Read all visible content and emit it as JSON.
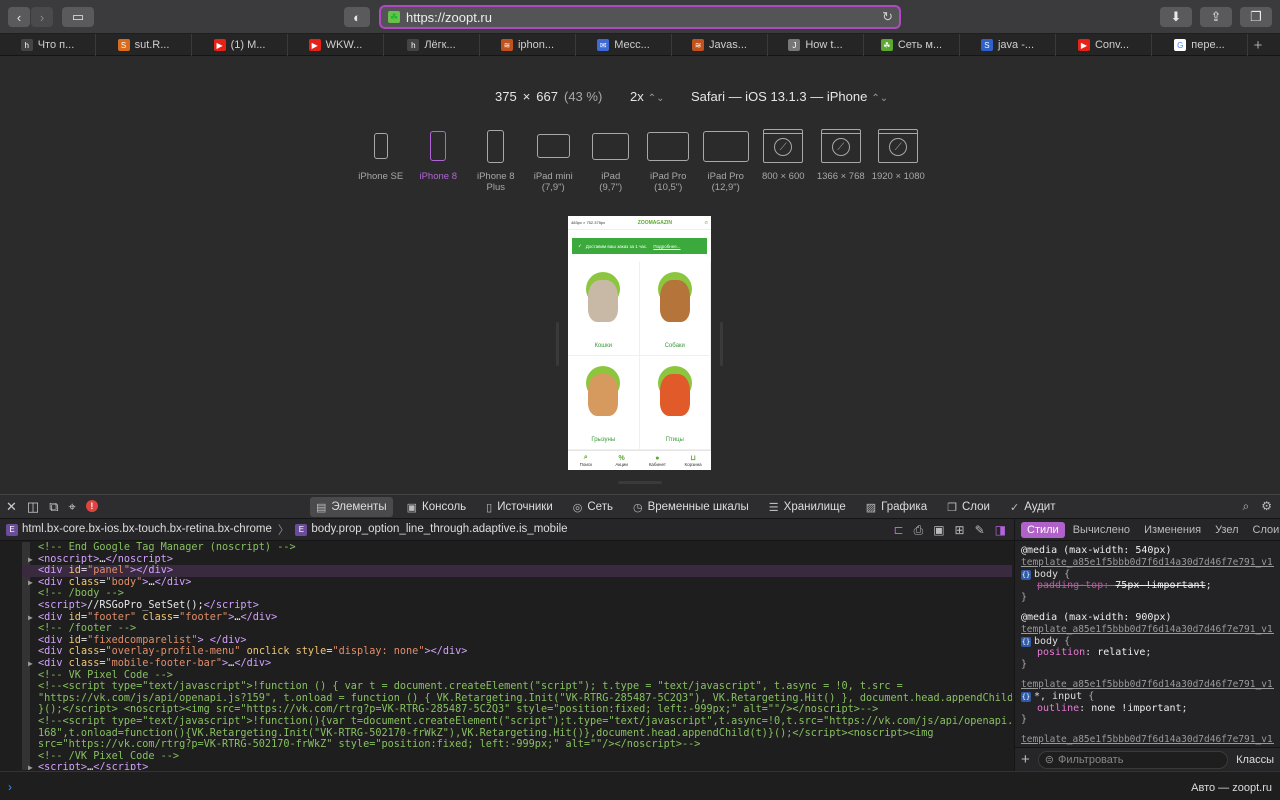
{
  "browser": {
    "url": "https://zoopt.ru",
    "tabs": [
      {
        "label": "Что п...",
        "favicon": "h",
        "color": "#444"
      },
      {
        "label": "sut.R...",
        "favicon": "S",
        "color": "#d86b1e"
      },
      {
        "label": "(1) M...",
        "favicon": "▶",
        "color": "#e62117"
      },
      {
        "label": "WKW...",
        "favicon": "▶",
        "color": "#e62117"
      },
      {
        "label": "Лёгк...",
        "favicon": "h",
        "color": "#444"
      },
      {
        "label": "iphon...",
        "favicon": "≋",
        "color": "#c0521e"
      },
      {
        "label": "Месс...",
        "favicon": "✉",
        "color": "#3d6ad6"
      },
      {
        "label": "Javas...",
        "favicon": "≋",
        "color": "#c0521e"
      },
      {
        "label": "How t...",
        "favicon": "J",
        "color": "#777"
      },
      {
        "label": "Сеть м...",
        "favicon": "☘",
        "color": "#5ba82f"
      },
      {
        "label": "java -...",
        "favicon": "S",
        "color": "#2f61c9"
      },
      {
        "label": "Conv...",
        "favicon": "▶",
        "color": "#e62117"
      },
      {
        "label": "пере...",
        "favicon": "G",
        "color": "#fff"
      }
    ]
  },
  "responsive": {
    "width": "375",
    "times": "×",
    "height": "667",
    "percent": "(43 %)",
    "scale": "2x",
    "user_agent": "Safari — iOS 13.1.3 — iPhone",
    "devices": [
      {
        "line1": "iPhone SE",
        "line2": "",
        "kind": "phone-sm"
      },
      {
        "line1": "iPhone 8",
        "line2": "",
        "kind": "phone"
      },
      {
        "line1": "iPhone 8",
        "line2": "Plus",
        "kind": "phone-lg"
      },
      {
        "line1": "iPad mini",
        "line2": "(7,9\")",
        "kind": "tab-sm"
      },
      {
        "line1": "iPad",
        "line2": "(9,7\")",
        "kind": "tab"
      },
      {
        "line1": "iPad Pro",
        "line2": "(10,5\")",
        "kind": "tab-lg"
      },
      {
        "line1": "iPad Pro",
        "line2": "(12,9\")",
        "kind": "tab-xl"
      },
      {
        "line1": "800 × 600",
        "line2": "",
        "kind": "screen"
      },
      {
        "line1": "1366 × 768",
        "line2": "",
        "kind": "screen"
      },
      {
        "line1": "1920 × 1080",
        "line2": "",
        "kind": "screen"
      }
    ],
    "selected_device": "iPhone 8"
  },
  "phone_page": {
    "top_left": "483px × 752.375px",
    "logo": "ZOOMAGAZIN",
    "banner": "Доставим ваш заказ за 1 час.",
    "banner_link": "Подробнее...",
    "categories": [
      {
        "label": "Кошки",
        "color": "#c8b9a6"
      },
      {
        "label": "Собаки",
        "color": "#b5743a"
      },
      {
        "label": "Грызуны",
        "color": "#d79a5e"
      },
      {
        "label": "Птицы",
        "color": "#e05a2a"
      }
    ],
    "bottom_nav": [
      {
        "icon": "⌕",
        "label": "Поиск"
      },
      {
        "icon": "%",
        "label": "Акции"
      },
      {
        "icon": "●",
        "label": "Кабинет"
      },
      {
        "icon": "⊔",
        "label": "Корзина"
      }
    ]
  },
  "inspector": {
    "tabs": [
      {
        "label": "Элементы",
        "icon": "▤",
        "active": true
      },
      {
        "label": "Консоль",
        "icon": "▣",
        "active": false
      },
      {
        "label": "Источники",
        "icon": "▯",
        "active": false
      },
      {
        "label": "Сеть",
        "icon": "◎",
        "active": false
      },
      {
        "label": "Временные шкалы",
        "icon": "◷",
        "active": false
      },
      {
        "label": "Хранилище",
        "icon": "☰",
        "active": false
      },
      {
        "label": "Графика",
        "icon": "▨",
        "active": false
      },
      {
        "label": "Слои",
        "icon": "❐",
        "active": false
      },
      {
        "label": "Аудит",
        "icon": "✓",
        "active": false
      }
    ],
    "error_count": "!",
    "breadcrumb": [
      "html.bx-core.bx-ios.bx-touch.bx-retina.bx-chrome",
      "body.prop_option_line_through.adaptive.is_mobile"
    ],
    "breadcrumb_badge": "E",
    "dom_lines": [
      {
        "html": "<span class='cmt'>&lt;!-- End Google Tag Manager (noscript) --&gt;</span>",
        "tri": false,
        "sel": false
      },
      {
        "html": "<span class='tg'>&lt;noscript&gt;</span>…<span class='tg'>&lt;/noscript&gt;</span>",
        "tri": true,
        "sel": false
      },
      {
        "html": "<span class='tg'>&lt;div </span><span class='an'>id</span>=<span class='av'>\"panel\"</span><span class='tg'>&gt;&lt;/div&gt;</span>",
        "tri": false,
        "sel": true
      },
      {
        "html": "<span class='tg'>&lt;div </span><span class='an'>class</span>=<span class='av'>\"body\"</span><span class='tg'>&gt;</span>…<span class='tg'>&lt;/div&gt;</span>",
        "tri": true,
        "sel": false
      },
      {
        "html": "<span class='cmt'>&lt;!-- /body --&gt;</span>",
        "tri": false,
        "sel": false
      },
      {
        "html": "<span class='tg'>&lt;script&gt;</span>//RSGoPro_SetSet();<span class='tg'>&lt;/script&gt;</span>",
        "tri": false,
        "sel": false
      },
      {
        "html": "<span class='tg'>&lt;div </span><span class='an'>id</span>=<span class='av'>\"footer\"</span> <span class='an'>class</span>=<span class='av'>\"footer\"</span><span class='tg'>&gt;</span>…<span class='tg'>&lt;/div&gt;</span>",
        "tri": true,
        "sel": false
      },
      {
        "html": "<span class='cmt'>&lt;!-- /footer --&gt;</span>",
        "tri": false,
        "sel": false
      },
      {
        "html": "<span class='tg'>&lt;div </span><span class='an'>id</span>=<span class='av'>\"fixedcomparelist\"</span><span class='tg'>&gt; &lt;/div&gt;</span>",
        "tri": false,
        "sel": false
      },
      {
        "html": "<span class='tg'>&lt;div </span><span class='an'>class</span>=<span class='av'>\"overlay-profile-menu\"</span> <span class='an'>onclick</span> <span class='an'>style</span>=<span class='av'>\"display: none\"</span><span class='tg'>&gt;&lt;/div&gt;</span>",
        "tri": false,
        "sel": false
      },
      {
        "html": "<span class='tg'>&lt;div </span><span class='an'>class</span>=<span class='av'>\"mobile-footer-bar\"</span><span class='tg'>&gt;</span>…<span class='tg'>&lt;/div&gt;</span>",
        "tri": true,
        "sel": false
      },
      {
        "html": "<span class='cmt'>&lt;!-- VK Pixel Code --&gt;</span>",
        "tri": false,
        "sel": false
      },
      {
        "html": "<span class='cmt'>&lt;!--&lt;script type=\"text/javascript\"&gt;!function () { var t = document.createElement(\"script\"); t.type = \"text/javascript\", t.async = !0, t.src =</span>",
        "tri": false,
        "sel": false
      },
      {
        "html": "<span class='cmt'>\"https://vk.com/js/api/openapi.js?159\", t.onload = function () { VK.Retargeting.Init(\"VK-RTRG-285487-5C2Q3\"), VK.Retargeting.Hit() }, document.head.appendChild(t)</span>",
        "tri": false,
        "sel": false
      },
      {
        "html": "<span class='cmt'>}();&lt;/script&gt; &lt;noscript&gt;&lt;img src=\"https://vk.com/rtrg?p=VK-RTRG-285487-5C2Q3\" style=\"position:fixed; left:-999px;\" alt=\"\"/&gt;&lt;/noscript&gt;--&gt;</span>",
        "tri": false,
        "sel": false
      },
      {
        "html": "<span class='cmt'>&lt;!--&lt;script type=\"text/javascript\"&gt;!function(){var t=document.createElement(\"script\");t.type=\"text/javascript\",t.async=!0,t.src=\"https://vk.com/js/api/openapi.js?</span>",
        "tri": false,
        "sel": false
      },
      {
        "html": "<span class='cmt'>168\",t.onload=function(){VK.Retargeting.Init(\"VK-RTRG-502170-frWkZ\"),VK.Retargeting.Hit()},document.head.appendChild(t)}();&lt;/script&gt;&lt;noscript&gt;&lt;img</span>",
        "tri": false,
        "sel": false
      },
      {
        "html": "<span class='cmt'>src=\"https://vk.com/rtrg?p=VK-RTRG-502170-frWkZ\" style=\"position:fixed; left:-999px;\" alt=\"\"/&gt;&lt;/noscript&gt;--&gt;</span>",
        "tri": false,
        "sel": false
      },
      {
        "html": "<span class='cmt'>&lt;!-- /VK Pixel Code --&gt;</span>",
        "tri": false,
        "sel": false
      },
      {
        "html": "<span class='tg'>&lt;script&gt;</span>…<span class='tg'>&lt;/script&gt;</span>",
        "tri": true,
        "sel": false
      }
    ],
    "styles_tabs": [
      {
        "label": "Стили",
        "active": true
      },
      {
        "label": "Вычислено",
        "active": false
      },
      {
        "label": "Изменения",
        "active": false
      },
      {
        "label": "Узел",
        "active": false
      },
      {
        "label": "Слои",
        "active": false
      }
    ],
    "rules": [
      {
        "media": "@media (max-width: 540px)",
        "source": "template_a85e1f5bbb0d7f6d14a30d7d46f7e791_v1.css:...",
        "selector": "body",
        "props": [
          {
            "name": "padding-top",
            "value": "75px !important",
            "struck": true
          }
        ]
      },
      {
        "media": "@media (max-width: 900px)",
        "source": "template_a85e1f5bbb0d7f6d14a30d7d46f7e791_v1.css:...",
        "selector": "body",
        "props": [
          {
            "name": "position",
            "value": "relative",
            "struck": false
          }
        ]
      },
      {
        "media": "",
        "source": "template_a85e1f5bbb0d7f6d14a30d7d46f7e791_v1.css:...",
        "selector": "*, input",
        "props": [
          {
            "name": "outline",
            "value": "none !important",
            "struck": false
          }
        ]
      },
      {
        "media": "",
        "source": "template_a85e1f5bbb0d7f6d14a30d7d46f7e791_v1.css:...",
        "selector": "",
        "props": []
      }
    ],
    "filter_placeholder": "Фильтровать",
    "classes_label": "Классы",
    "console_context": "Авто — zoopt.ru"
  }
}
